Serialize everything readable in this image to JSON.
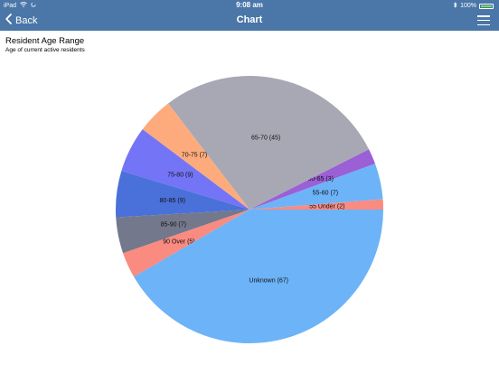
{
  "status_bar": {
    "carrier": "iPad",
    "time": "9:08 am",
    "battery": "100%"
  },
  "nav": {
    "back_label": "Back",
    "title": "Chart"
  },
  "chart_data": {
    "type": "pie",
    "title": "Resident Age Range",
    "subtitle": "Age of current active residents",
    "slices": [
      {
        "label": "55 Under (2)",
        "value": 2,
        "color": "#f98b80"
      },
      {
        "label": "55-60 (7)",
        "value": 7,
        "color": "#6db3f8"
      },
      {
        "label": "60-65 (3)",
        "value": 3,
        "color": "#9b5fd6"
      },
      {
        "label": "65-70 (45)",
        "value": 45,
        "color": "#a8a8b4"
      },
      {
        "label": "70-75 (7)",
        "value": 7,
        "color": "#fdab7d"
      },
      {
        "label": "75-80 (9)",
        "value": 9,
        "color": "#7474f6"
      },
      {
        "label": "80-85 (9)",
        "value": 9,
        "color": "#4a70d9"
      },
      {
        "label": "85-90 (7)",
        "value": 7,
        "color": "#74788c"
      },
      {
        "label": "90 Over (5)",
        "value": 5,
        "color": "#f98b80"
      },
      {
        "label": "Unknown (67)",
        "value": 67,
        "color": "#6db3f8"
      }
    ],
    "legend": "none",
    "direction": "counterclockwise"
  }
}
